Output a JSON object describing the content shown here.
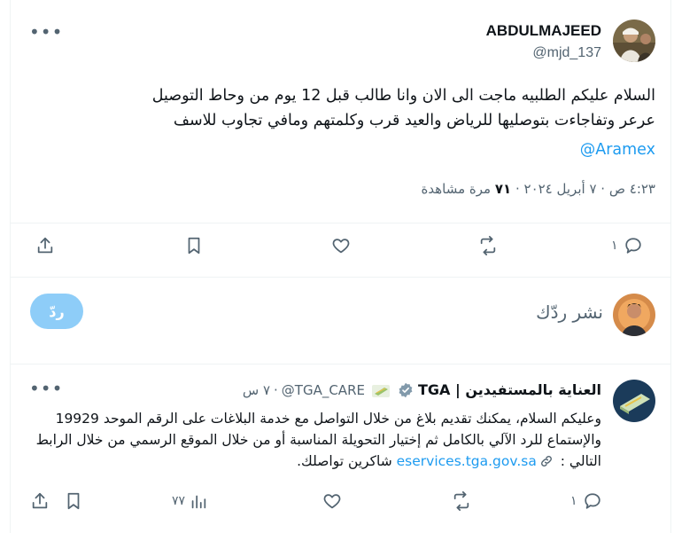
{
  "main_tweet": {
    "author_name": "ABDULMAJEED",
    "author_handle": "@mjd_137",
    "more_label": "•••",
    "text": "السلام عليكم الطلبيه ماجت الى الان وانا طالب قبل 12 يوم من  وحاط التوصيل\nعرعر وتفاجاءت بتوصليها للرياض والعيد قرب وكلمتهم ومافي تجاوب للاسف",
    "mention": "@Aramex",
    "time": "٤:٢٣ ص",
    "date": "٧ أبريل ٢٠٢٤",
    "meta_sep": "·",
    "views_count": "٧١",
    "views_label": "مرة مشاهدة",
    "reply_count": "١"
  },
  "reply_composer": {
    "placeholder": "نشر ردّك",
    "button_label": "ردّ"
  },
  "reply_tweet": {
    "author_name": "العناية بالمستفيدين | TGA",
    "author_handle": "@TGA_CARE",
    "time": "٧ س",
    "dot": "·",
    "more_label": "•••",
    "text_before_link": "وعليكم السلام، يمكنك تقديم بلاغ من خلال التواصل مع خدمة البلاغات على الرقم الموحد 19929 والإستماع للرد الآلي بالكامل ثم إختيار التحويلة المناسبة أو من خلال الموقع الرسمي من خلال الرابط التالي",
    "link_text": "eservices.tga.gov.sa",
    "text_after_link": "شاكرين تواصلك.",
    "colon": " : ",
    "reply_count": "١",
    "views_count": "٧٧"
  },
  "colors": {
    "accent": "#1d9bf0",
    "reply_button": "#8ecdf8",
    "muted_text": "#536471",
    "divider": "#eff3f4"
  },
  "icons": {
    "share": "share-icon",
    "bookmark": "bookmark-icon",
    "like": "heart-icon",
    "retweet": "retweet-icon",
    "reply": "reply-icon",
    "views": "views-icon",
    "verified": "verified-badge-icon",
    "link": "link-icon"
  }
}
